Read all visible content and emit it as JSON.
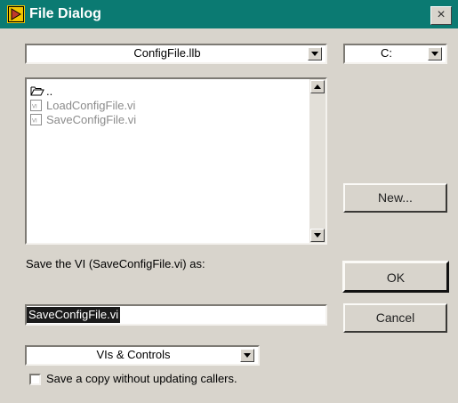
{
  "window": {
    "title": "File Dialog",
    "close_label": "×"
  },
  "location": {
    "selected": "ConfigFile.llb",
    "icon": "chevron-down-icon"
  },
  "drive": {
    "selected": "C:",
    "icon": "chevron-down-icon"
  },
  "file_list": {
    "items": [
      {
        "label": "..",
        "icon": "open-folder-icon"
      },
      {
        "label": "LoadConfigFile.vi",
        "icon": "vi-file-icon"
      },
      {
        "label": "SaveConfigFile.vi",
        "icon": "vi-file-icon"
      }
    ]
  },
  "buttons": {
    "new": "New...",
    "ok": "OK",
    "cancel": "Cancel"
  },
  "save_prompt": "Save the VI (SaveConfigFile.vi) as:",
  "filename": {
    "value": "SaveConfigFile.vi"
  },
  "filter": {
    "selected": "VIs & Controls"
  },
  "save_copy": {
    "label": "Save a copy without updating callers.",
    "checked": false
  },
  "colors": {
    "titlebar": "#0b7a72",
    "dialog_bg": "#d8d4cc",
    "selection": "#1a1a1a"
  }
}
